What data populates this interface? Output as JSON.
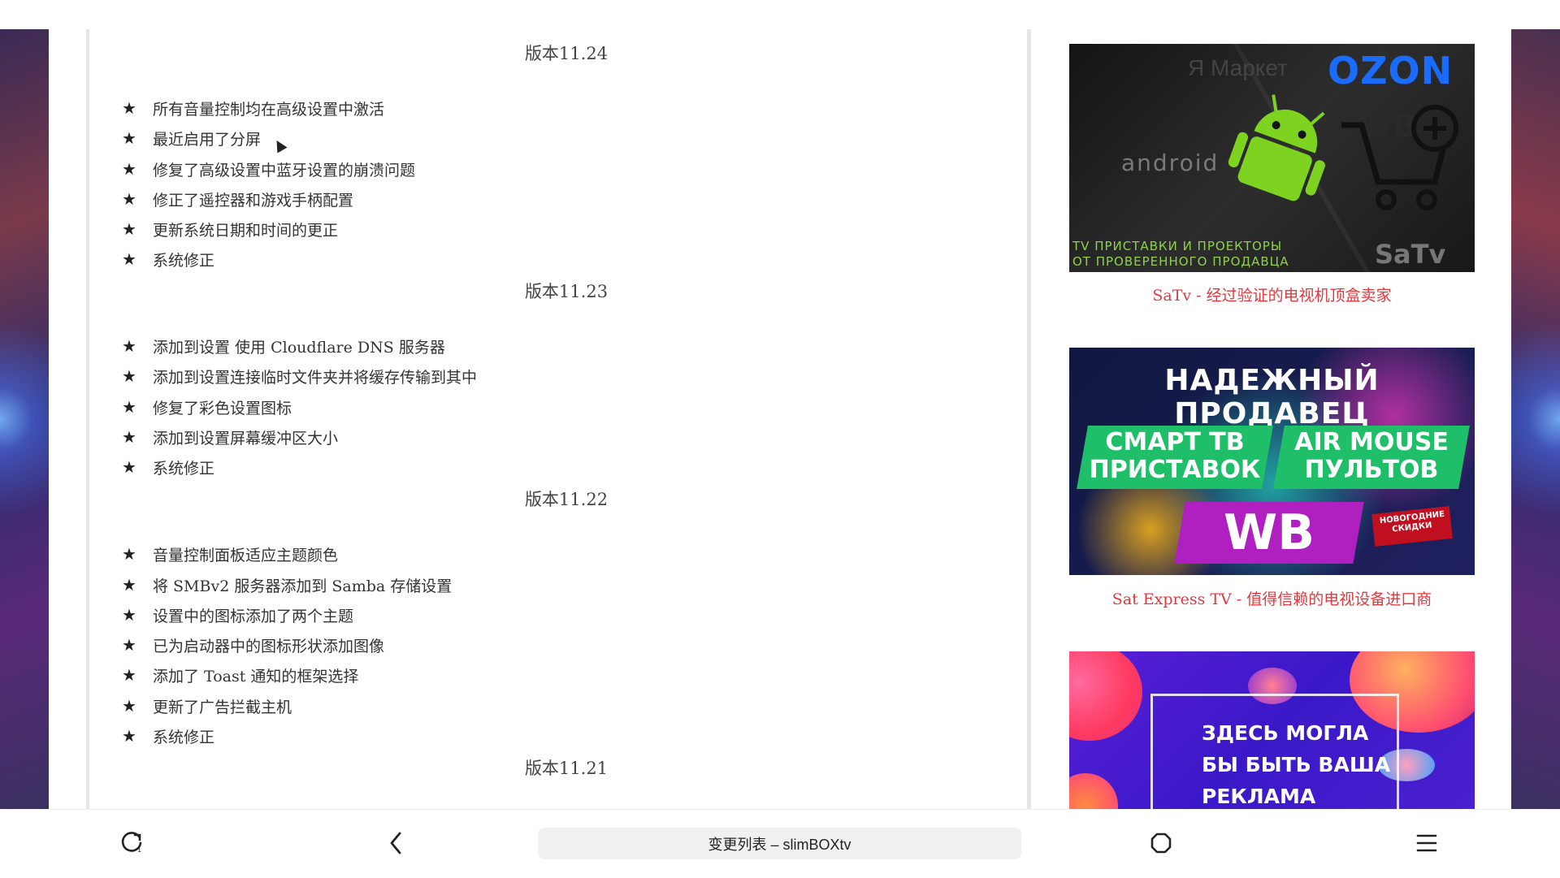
{
  "changelog": {
    "sections": [
      {
        "version": "版本11.24",
        "items": [
          "所有音量控制均在高级设置中激活",
          "最近启用了分屏",
          "修复了高级设置中蓝牙设置的崩溃问题",
          "修正了遥控器和游戏手柄配置",
          "更新系统日期和时间的更正",
          "系统修正"
        ]
      },
      {
        "version": "版本11.23",
        "items": [
          "添加到设置 使用 Cloudflare DNS 服务器",
          "添加到设置连接临时文件夹并将缓存传输到其中",
          "修复了彩色设置图标",
          "添加到设置屏幕缓冲区大小",
          "系统修正"
        ]
      },
      {
        "version": "版本11.22",
        "items": [
          "音量控制面板适应主题颜色",
          "将 SMBv2 服务器添加到 Samba 存储设置",
          "设置中的图标添加了两个主题",
          "已为启动器中的图标形状添加图像",
          "添加了 Toast 通知的框架选择",
          "更新了广告拦截主机",
          "系统修正"
        ]
      },
      {
        "version": "版本11.21",
        "items": []
      }
    ]
  },
  "ads": [
    {
      "caption": "SaTv - 经过验证的电视机顶盒卖家",
      "text": {
        "market": "Я Маркет",
        "ozon": "OZON",
        "wb": "WB",
        "android": "android",
        "line1": "TV ПРИСТАВКИ И ПРОЕКТОРЫ",
        "line2": "ОТ ПРОВЕРЕННОГО ПРОДАВЦА",
        "brand": "SaTv"
      }
    },
    {
      "caption": "Sat Express TV - 值得信赖的电视设备进口商",
      "text": {
        "headline": "НАДЕЖНЫЙ ПРОДАВЕЦ",
        "box1_line1": "СМАРТ ТВ",
        "box1_line2": "ПРИСТАВОК",
        "box2_line1": "AIR MOUSE",
        "box2_line2": "ПУЛЬТОВ",
        "wb": "WB",
        "tag_line1": "НОВОГОДНИЕ",
        "tag_line2": "СКИДКИ"
      }
    },
    {
      "caption": "",
      "text": {
        "line1": "ЗДЕСЬ МОГЛА",
        "line2": "БЫ БЫТЬ ВАША",
        "line3": "РЕКЛАМА"
      }
    }
  ],
  "bottom_bar": {
    "url_title": "变更列表 – slimBOXtv",
    "icons": [
      "refresh-icon",
      "back-icon",
      "home-icon",
      "menu-icon"
    ]
  },
  "colors": {
    "caption_red": "#e0393e",
    "android_green": "#7ed321"
  }
}
